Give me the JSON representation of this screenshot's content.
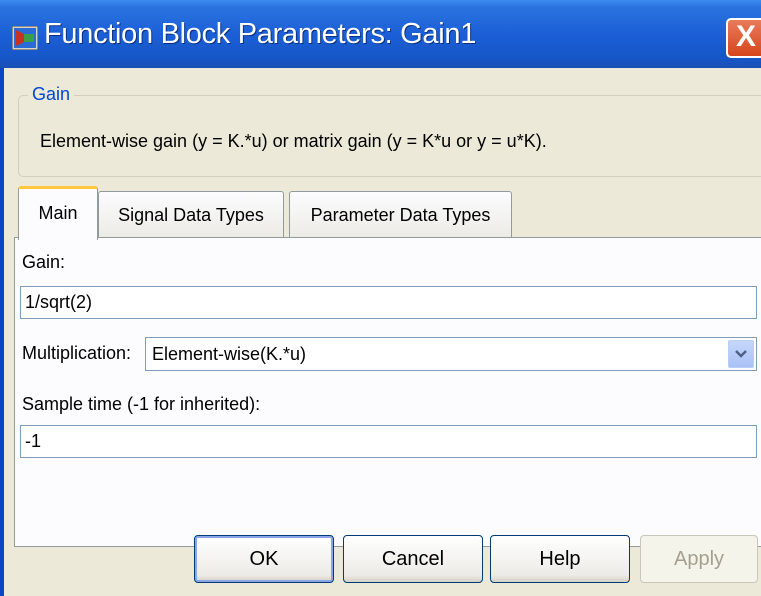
{
  "window": {
    "title": "Function Block Parameters: Gain1",
    "close_glyph": "X",
    "icon": "simulink-block-icon"
  },
  "block_group": {
    "legend": "Gain",
    "description": "Element-wise gain (y = K.*u) or matrix gain (y = K*u or y = u*K)."
  },
  "tabs": [
    {
      "label": "Main",
      "active": true
    },
    {
      "label": "Signal Data Types",
      "active": false
    },
    {
      "label": "Parameter Data Types",
      "active": false
    }
  ],
  "main": {
    "gain_label": "Gain:",
    "gain_value": "1/sqrt(2)",
    "multiplication_label": "Multiplication:",
    "multiplication_value": "Element-wise(K.*u)",
    "sample_time_label": "Sample time (-1 for inherited):",
    "sample_time_value": "-1"
  },
  "buttons": {
    "ok": "OK",
    "cancel": "Cancel",
    "help": "Help",
    "apply": "Apply"
  },
  "colors": {
    "titlebar": "#1c5fd6",
    "close_button": "#d6461c",
    "legend_text": "#0046d5",
    "active_tab_accent": "#ffc83c"
  }
}
